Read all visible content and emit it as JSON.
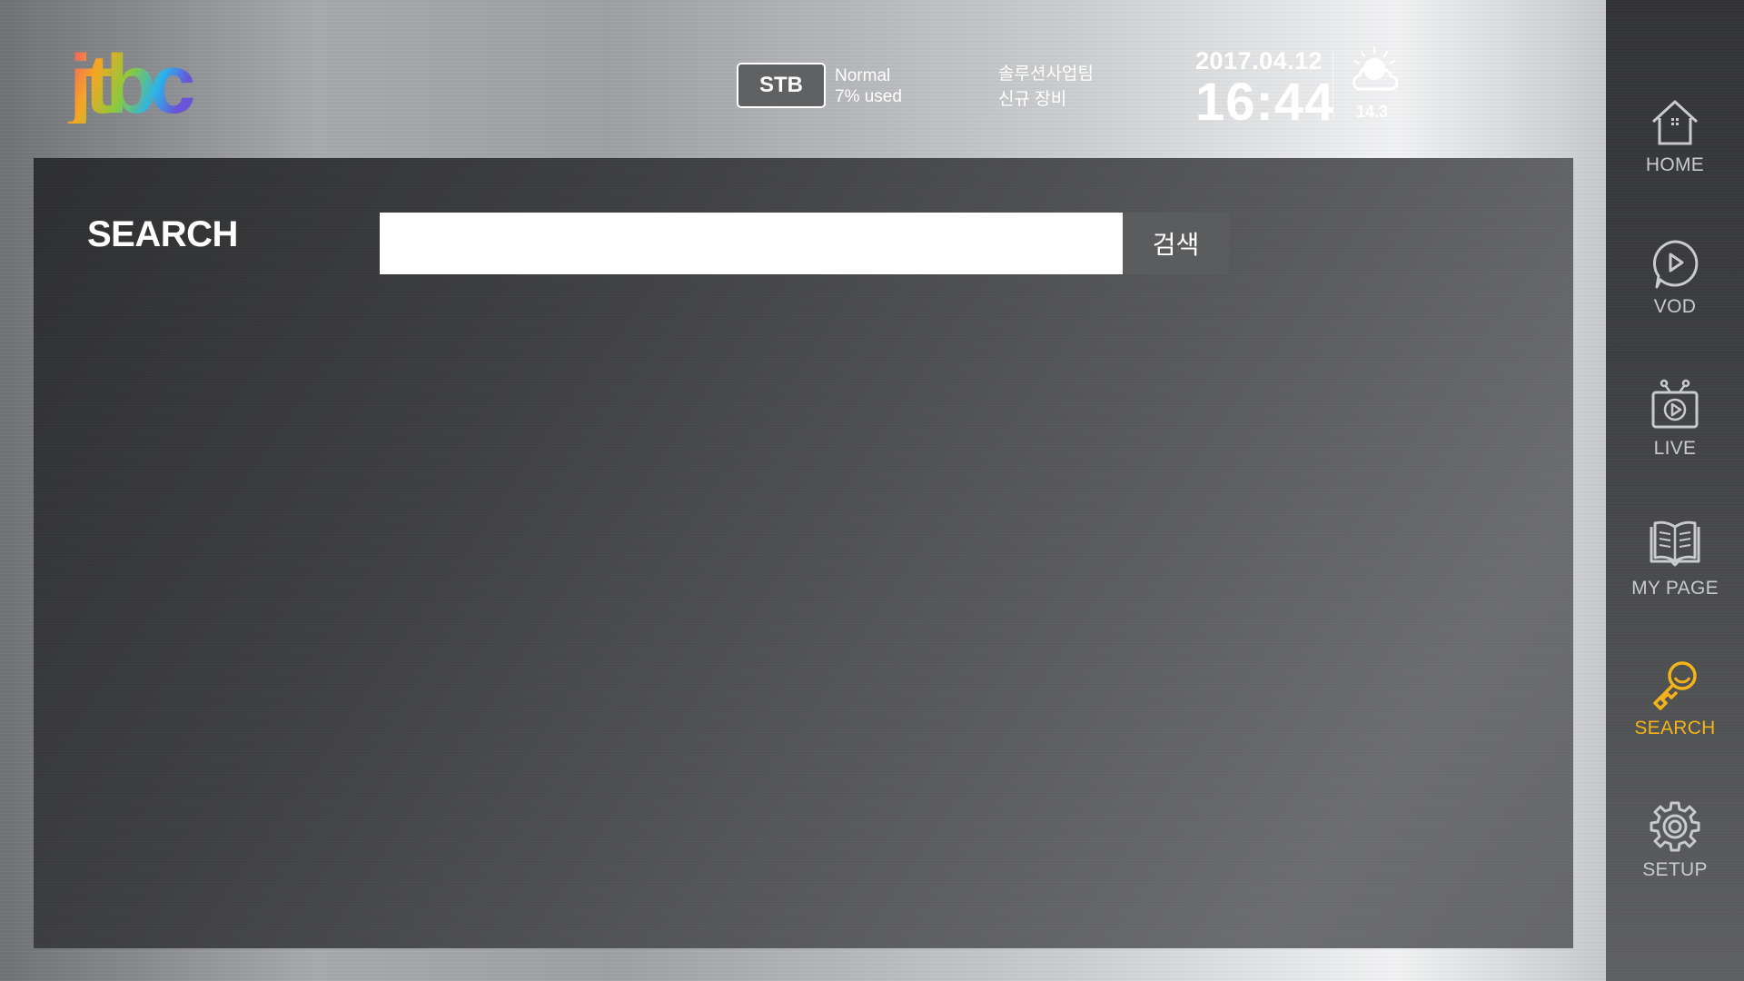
{
  "brand": {
    "logo_text": "jtbc"
  },
  "header": {
    "stb_label": "STB",
    "stb_state": "Normal",
    "stb_usage": "7% used",
    "team_line1": "솔루션사업팀",
    "team_line2": "신규 장비",
    "date": "2017.04.12",
    "time": "16:44",
    "weather_icon": "partly-cloudy-icon",
    "temperature": "14.3"
  },
  "main": {
    "title": "SEARCH",
    "search_input_value": "",
    "search_input_placeholder": "",
    "search_button_label": "검색"
  },
  "nav": {
    "items": [
      {
        "label": "HOME",
        "icon": "home-icon",
        "active": false
      },
      {
        "label": "VOD",
        "icon": "play-bubble-icon",
        "active": false
      },
      {
        "label": "LIVE",
        "icon": "tv-play-icon",
        "active": false
      },
      {
        "label": "MY PAGE",
        "icon": "book-icon",
        "active": false
      },
      {
        "label": "SEARCH",
        "icon": "key-search-icon",
        "active": true
      },
      {
        "label": "SETUP",
        "icon": "gear-icon",
        "active": false
      }
    ],
    "active_color": "#f2b418",
    "inactive_color": "#c9cacb"
  }
}
